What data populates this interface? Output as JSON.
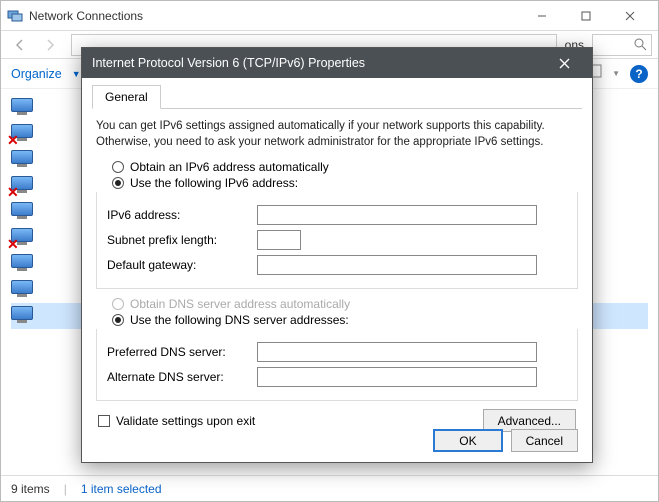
{
  "bg": {
    "title": "Network Connections",
    "organize": "Organize",
    "overflow_label": "ons",
    "status_items": "9 items",
    "status_selected": "1 item selected",
    "connections": [
      {
        "x": false
      },
      {
        "x": true
      },
      {
        "x": false
      },
      {
        "x": true
      },
      {
        "x": false
      },
      {
        "x": true
      },
      {
        "x": false
      },
      {
        "x": false
      },
      {
        "x": false
      }
    ]
  },
  "dlg": {
    "title": "Internet Protocol Version 6 (TCP/IPv6) Properties",
    "tab_general": "General",
    "desc": "You can get IPv6 settings assigned automatically if your network supports this capability. Otherwise, you need to ask your network administrator for the appropriate IPv6 settings.",
    "addr": {
      "auto_label": "Obtain an IPv6 address automatically",
      "manual_label": "Use the following IPv6 address:",
      "ipv6_label": "IPv6 address:",
      "prefix_label": "Subnet prefix length:",
      "gateway_label": "Default gateway:",
      "ipv6_value": "",
      "prefix_value": "",
      "gateway_value": ""
    },
    "dns": {
      "auto_label": "Obtain DNS server address automatically",
      "manual_label": "Use the following DNS server addresses:",
      "preferred_label": "Preferred DNS server:",
      "alternate_label": "Alternate DNS server:",
      "preferred_value": "",
      "alternate_value": ""
    },
    "validate_label": "Validate settings upon exit",
    "advanced_label": "Advanced...",
    "ok_label": "OK",
    "cancel_label": "Cancel"
  }
}
